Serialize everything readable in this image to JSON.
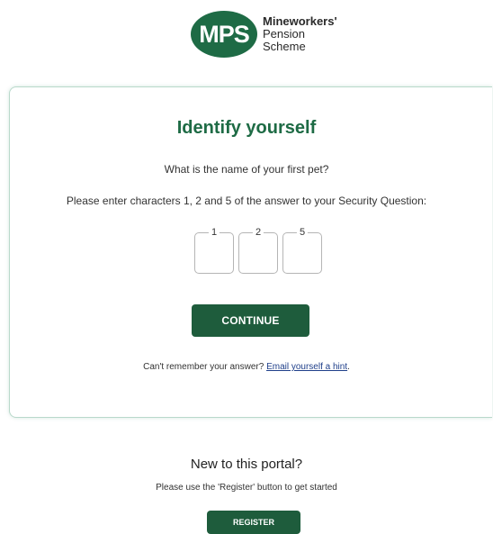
{
  "header": {
    "logo_initials": "MPS",
    "logo_line1": "Mineworkers'",
    "logo_line2": "Pension",
    "logo_line3": "Scheme"
  },
  "card": {
    "title": "Identify yourself",
    "question": "What is the name of your first pet?",
    "instruction": "Please enter characters 1, 2 and 5 of the answer to your Security Question:",
    "char_boxes": [
      {
        "label": "1",
        "value": ""
      },
      {
        "label": "2",
        "value": ""
      },
      {
        "label": "5",
        "value": ""
      }
    ],
    "continue_label": "CONTINUE",
    "hint_prefix": "Can't remember your answer?",
    "hint_link": "Email yourself a hint",
    "hint_suffix": "."
  },
  "register": {
    "title": "New to this portal?",
    "subtitle": "Please use the 'Register' button to get started",
    "button_label": "REGISTER"
  },
  "colors": {
    "brand_green": "#1e6b45",
    "button_green": "#1e5c3c",
    "link_blue": "#1f3f8a"
  }
}
